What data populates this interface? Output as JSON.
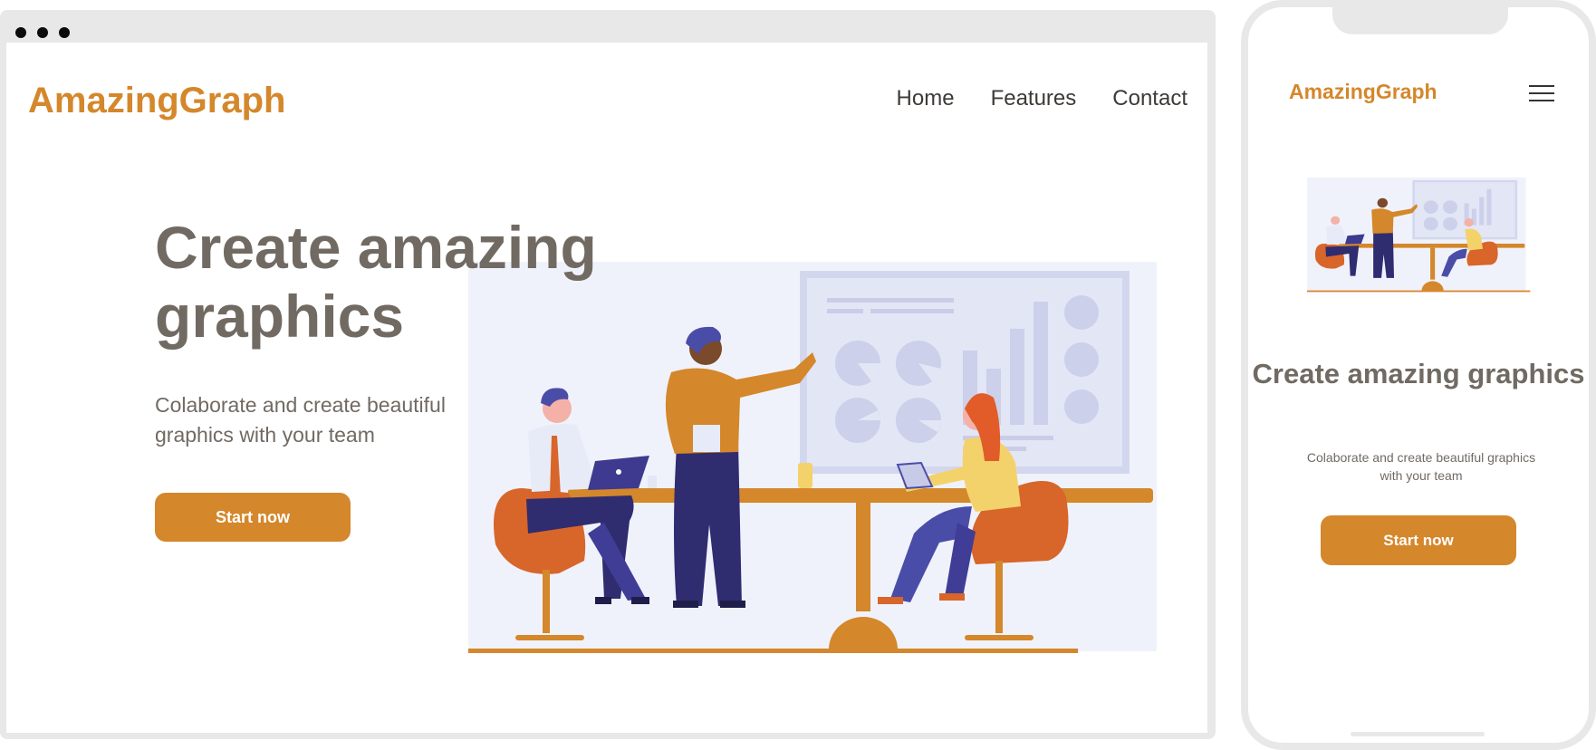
{
  "desktop": {
    "logo": "AmazingGraph",
    "nav": [
      "Home",
      "Features",
      "Contact"
    ],
    "hero": {
      "title_line1": "Create amazing",
      "title_line2": "graphics",
      "subtitle": "Colaborate and create beautiful graphics with your team",
      "cta": "Start now"
    }
  },
  "mobile": {
    "logo": "AmazingGraph",
    "menu_icon": "hamburger-menu-icon",
    "hero": {
      "title": "Create amazing graphics",
      "subtitle": "Colaborate and create beautiful graphics with your team",
      "cta": "Start now"
    }
  },
  "colors": {
    "brand": "#d4872b",
    "text": "#716a63",
    "frame": "#e8e8e8",
    "illustration_bg": "#f0f2fb",
    "navy": "#2f2c70",
    "orange_chair": "#d8652a"
  }
}
